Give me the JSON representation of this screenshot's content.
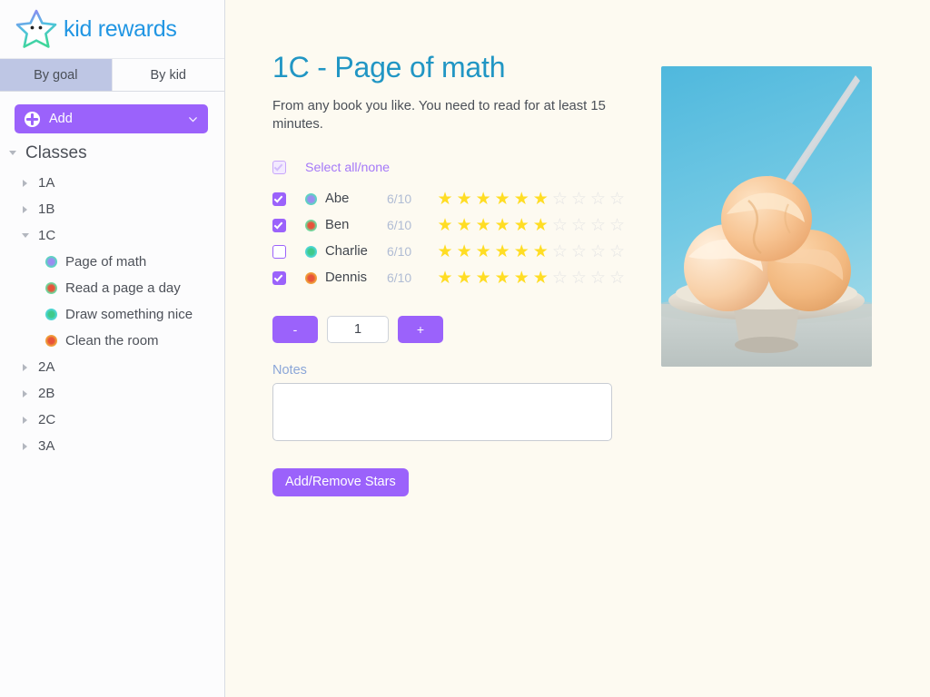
{
  "brand": {
    "name": "kid rewards",
    "logo_icon": "star-face-icon"
  },
  "tabs": [
    {
      "label": "By goal",
      "active": true
    },
    {
      "label": "By kid",
      "active": false
    }
  ],
  "toolbar": {
    "add_label": "Add",
    "add_icon": "plus-circle-icon",
    "dropdown_icon": "chevron-down-icon"
  },
  "sidebar": {
    "root_label": "Classes",
    "classes": [
      {
        "label": "1A",
        "expanded": false
      },
      {
        "label": "1B",
        "expanded": false
      },
      {
        "label": "1C",
        "expanded": true
      },
      {
        "label": "2A",
        "expanded": false
      },
      {
        "label": "2B",
        "expanded": false
      },
      {
        "label": "2C",
        "expanded": false
      },
      {
        "label": "3A",
        "expanded": false
      }
    ],
    "goals": [
      {
        "label": "Page of math",
        "color_outer": "#5bd6c0",
        "color_inner": "#9b8df0",
        "selected": true
      },
      {
        "label": "Read a page a day",
        "color_outer": "#6edba0",
        "color_inner": "#e8533a",
        "selected": false
      },
      {
        "label": "Draw something nice",
        "color_outer": "#4fd6d6",
        "color_inner": "#3fc98a",
        "selected": false
      },
      {
        "label": "Clean the room",
        "color_outer": "#f0a23c",
        "color_inner": "#e8533a",
        "selected": false
      }
    ]
  },
  "main": {
    "title": "1C - Page of math",
    "description": "From any book you like. You need to read for at least 15 minutes.",
    "select_all_label": "Select all/none",
    "select_all_checked": true,
    "stars_total": 10,
    "kids": [
      {
        "name": "Abe",
        "score": "6/10",
        "stars_filled": 6,
        "checked": true,
        "color_outer": "#5bd6c0",
        "color_inner": "#9b8df0"
      },
      {
        "name": "Ben",
        "score": "6/10",
        "stars_filled": 6,
        "checked": true,
        "color_outer": "#6edba0",
        "color_inner": "#e8533a"
      },
      {
        "name": "Charlie",
        "score": "6/10",
        "stars_filled": 6,
        "checked": false,
        "color_outer": "#4fd6d6",
        "color_inner": "#3fc98a"
      },
      {
        "name": "Dennis",
        "score": "6/10",
        "stars_filled": 6,
        "checked": true,
        "color_outer": "#f0a23c",
        "color_inner": "#e8533a"
      }
    ],
    "stepper": {
      "minus_label": "-",
      "plus_label": "+",
      "value": "1"
    },
    "notes_label": "Notes",
    "notes_value": "",
    "submit_label": "Add/Remove Stars",
    "photo_alt": "ice-cream-scoops-photo"
  },
  "colors": {
    "accent_purple": "#9b62fb",
    "title_blue": "#2196c4",
    "brand_blue": "#2196e3",
    "star_on": "#ffdd24",
    "star_off": "#e4e4e4",
    "page_bg": "#fdfaf1"
  }
}
